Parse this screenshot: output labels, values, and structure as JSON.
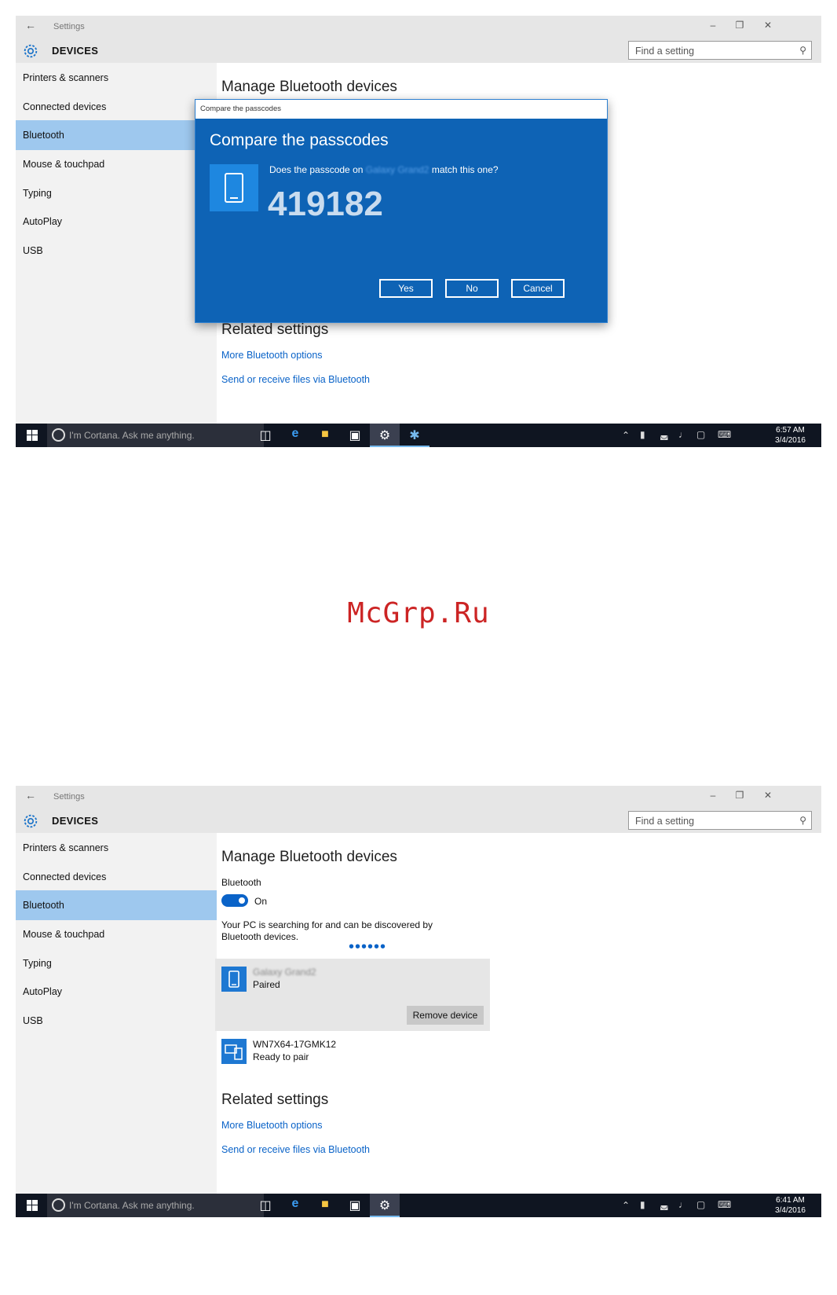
{
  "watermark": "McGrp.Ru",
  "screen1": {
    "window_title": "Settings",
    "section": "DEVICES",
    "search_placeholder": "Find a setting",
    "nav": [
      "Printers & scanners",
      "Connected devices",
      "Bluetooth",
      "Mouse & touchpad",
      "Typing",
      "AutoPlay",
      "USB"
    ],
    "selected_nav": "Bluetooth",
    "page_title": "Manage Bluetooth devices",
    "related_title": "Related settings",
    "links": [
      "More Bluetooth options",
      "Send or receive files via Bluetooth"
    ],
    "dialog": {
      "window_title": "Compare the passcodes",
      "heading": "Compare the passcodes",
      "question_prefix": "Does the passcode on",
      "device_name": "Galaxy Grand2",
      "question_suffix": "match this one?",
      "passcode": "419182",
      "buttons": [
        "Yes",
        "No",
        "Cancel"
      ]
    },
    "taskbar": {
      "cortana": "I'm Cortana. Ask me anything.",
      "time": "6:57 AM",
      "date": "3/4/2016"
    }
  },
  "screen2": {
    "window_title": "Settings",
    "section": "DEVICES",
    "search_placeholder": "Find a setting",
    "nav": [
      "Printers & scanners",
      "Connected devices",
      "Bluetooth",
      "Mouse & touchpad",
      "Typing",
      "AutoPlay",
      "USB"
    ],
    "selected_nav": "Bluetooth",
    "page_title": "Manage Bluetooth devices",
    "bluetooth_label": "Bluetooth",
    "toggle_state": "On",
    "searching_text": "Your PC is searching for and can be discovered by Bluetooth devices.",
    "devices": [
      {
        "name": "Galaxy Grand2",
        "status": "Paired",
        "action": "Remove device"
      },
      {
        "name": "WN7X64-17GMK12",
        "status": "Ready to pair"
      }
    ],
    "related_title": "Related settings",
    "links": [
      "More Bluetooth options",
      "Send or receive files via Bluetooth"
    ],
    "taskbar": {
      "cortana": "I'm Cortana. Ask me anything.",
      "time": "6:41 AM",
      "date": "3/4/2016"
    }
  },
  "colors": {
    "accent": "#0e63b5",
    "link": "#0a63c8",
    "selected_nav": "#9ec8ee",
    "taskbar": "#0f1521"
  }
}
